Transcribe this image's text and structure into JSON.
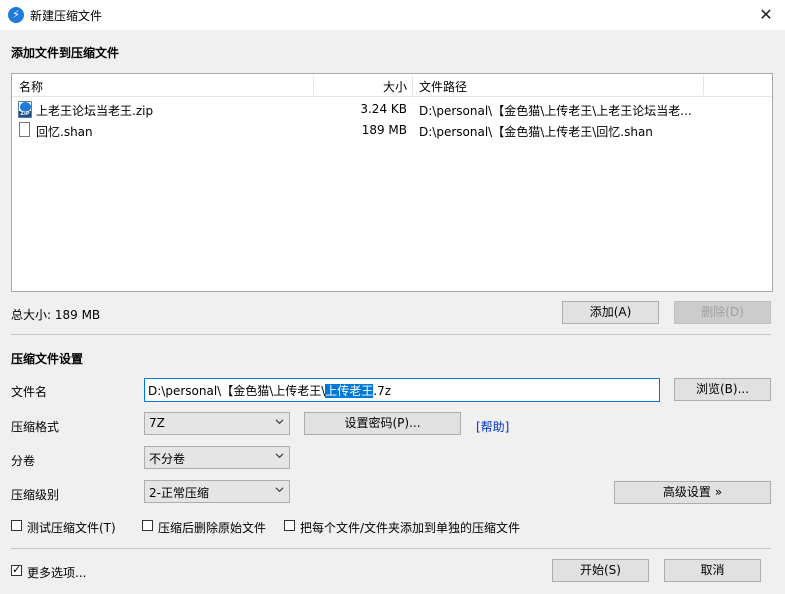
{
  "window": {
    "title": "新建压缩文件",
    "close_glyph": "✕",
    "app_icon_glyph": "⚡"
  },
  "add_section": {
    "title": "添加文件到压缩文件",
    "columns": {
      "name": "名称",
      "size": "大小",
      "path": "文件路径"
    },
    "files": [
      {
        "name": "上老王论坛当老王.zip",
        "size": "3.24 KB",
        "path": "D:\\personal\\【金色猫\\上传老王\\上老王论坛当老...",
        "icon": "zip-file-icon"
      },
      {
        "name": "回忆.shan",
        "size": "189 MB",
        "path": "D:\\personal\\【金色猫\\上传老王\\回忆.shan",
        "icon": "file-icon"
      }
    ],
    "total_size": "总大小: 189 MB",
    "add_button": "添加(A)",
    "delete_button": "删除(D)"
  },
  "settings": {
    "title": "压缩文件设置",
    "filename_label": "文件名",
    "filename_prefix": "D:\\personal\\【金色猫\\上传老王\\",
    "filename_selected": "上传老王",
    "filename_suffix": ".7z",
    "browse_button": "浏览(B)...",
    "format_label": "压缩格式",
    "format_value": "7Z",
    "password_button": "设置密码(P)...",
    "help_link": "[帮助]",
    "split_label": "分卷",
    "split_value": "不分卷",
    "level_label": "压缩级别",
    "level_value": "2-正常压缩",
    "advanced_button": "高级设置 »",
    "options": [
      {
        "label": "测试压缩文件(T)",
        "checked": false
      },
      {
        "label": "压缩后删除原始文件",
        "checked": false
      },
      {
        "label": "把每个文件/文件夹添加到单独的压缩文件",
        "checked": false
      }
    ]
  },
  "footer": {
    "more_options_label": "更多选项...",
    "more_options_checked": true,
    "tick_glyph": "✓",
    "start_button": "开始(S)",
    "cancel_button": "取消"
  }
}
